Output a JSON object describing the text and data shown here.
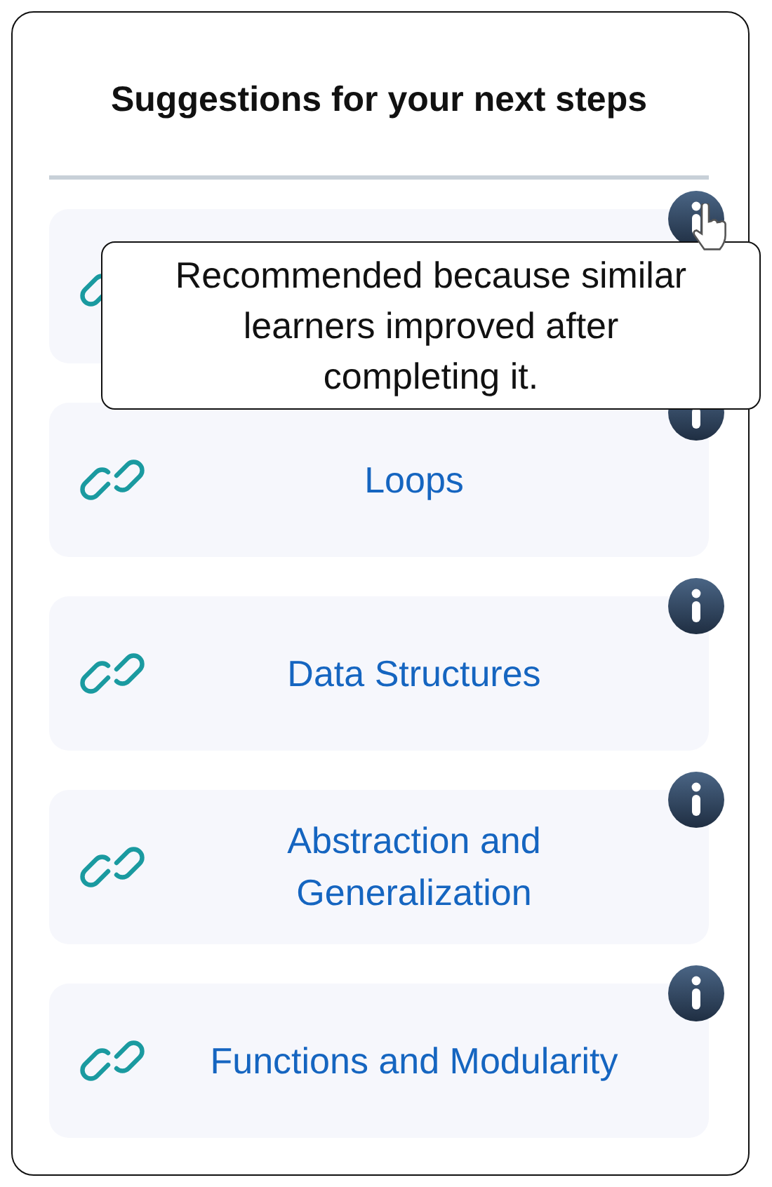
{
  "title": "Suggestions for your next steps",
  "suggestions": [
    {
      "tooltip": "Recommended because similar learners improved after completing it.",
      "hovered": true
    },
    {
      "label": "Loops",
      "hovered": false
    },
    {
      "label": "Data Structures",
      "hovered": false
    },
    {
      "label": "Abstraction and Generalization",
      "hovered": false
    },
    {
      "label": "Functions and Modularity",
      "hovered": false
    }
  ]
}
